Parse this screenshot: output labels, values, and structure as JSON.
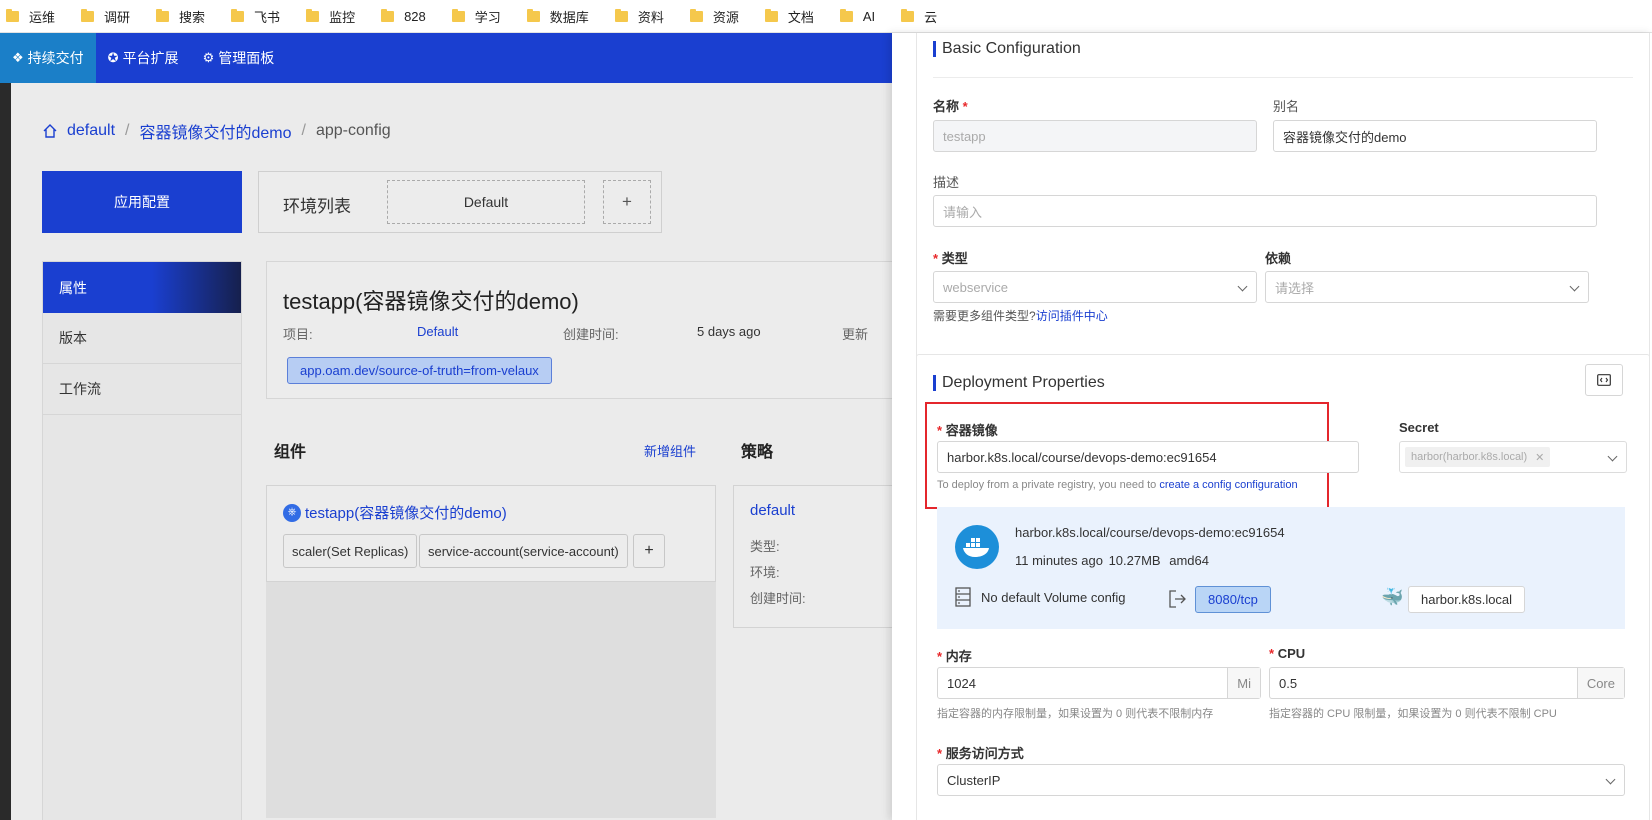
{
  "bookmarks": [
    "运维",
    "调研",
    "搜索",
    "飞书",
    "监控",
    "828",
    "学习",
    "数据库",
    "资料",
    "资源",
    "文档",
    "AI",
    "云"
  ],
  "nav": {
    "items": [
      {
        "label": "持续交付",
        "icon": "layers-icon"
      },
      {
        "label": "平台扩展",
        "icon": "plugin-icon"
      },
      {
        "label": "管理面板",
        "icon": "gear-icon"
      }
    ]
  },
  "breadcrumb": {
    "home": "default",
    "app": "容器镜像交付的demo",
    "current": "app-config"
  },
  "app_config_label": "应用配置",
  "env": {
    "label": "环境列表",
    "default": "Default",
    "add": "+"
  },
  "side_menu": [
    "属性",
    "版本",
    "工作流"
  ],
  "app_info": {
    "title": "testapp(容器镜像交付的demo)",
    "project_label": "项目:",
    "project_value": "Default",
    "created_label": "创建时间:",
    "created_value": "5 days ago",
    "updated_label": "更新",
    "tag": "app.oam.dev/source-of-truth=from-velaux"
  },
  "components": {
    "title": "组件",
    "add_label": "新增组件",
    "card": {
      "name": "testapp(容器镜像交付的demo)",
      "traits": [
        "scaler(Set Replicas)",
        "service-account(service-account)"
      ],
      "add": "+"
    }
  },
  "policies": {
    "title": "策略",
    "card": {
      "name": "default",
      "type_label": "类型:",
      "env_label": "环境:",
      "created_label": "创建时间:"
    }
  },
  "basic": {
    "title": "Basic Configuration",
    "name_label": "名称",
    "name_value": "testapp",
    "alias_label": "别名",
    "alias_value": "容器镜像交付的demo",
    "desc_label": "描述",
    "desc_placeholder": "请输入",
    "type_label": "类型",
    "type_value": "webservice",
    "depends_label": "依赖",
    "depends_placeholder": "请选择",
    "hint_prefix": "需要更多组件类型?",
    "hint_link": "访问插件中心"
  },
  "deploy": {
    "title": "Deployment Properties",
    "image_label": "容器镜像",
    "image_value": "harbor.k8s.local/course/devops-demo:ec91654",
    "image_hint_prefix": "To deploy from a private registry, you need to",
    "image_hint_link": "create a config configuration",
    "secret_label": "Secret",
    "secret_tag": "harbor(harbor.k8s.local)",
    "image_card": {
      "name": "harbor.k8s.local/course/devops-demo:ec91654",
      "age": "11 minutes ago",
      "size": "10.27MB",
      "arch": "amd64",
      "volume": "No default Volume config",
      "port": "8080/tcp",
      "registry": "harbor.k8s.local"
    },
    "memory_label": "内存",
    "memory_value": "1024",
    "memory_unit": "Mi",
    "memory_hint": "指定容器的内存限制量，如果设置为 0 则代表不限制内存",
    "cpu_label": "CPU",
    "cpu_value": "0.5",
    "cpu_unit": "Core",
    "cpu_hint": "指定容器的 CPU 限制量，如果设置为 0 则代表不限制 CPU",
    "service_label": "服务访问方式",
    "service_value": "ClusterIP"
  },
  "required_mark": "*",
  "colors": {
    "primary": "#1a3fd0",
    "active_nav": "#1b7fc8",
    "required": "#e8272a",
    "highlight_box": "#e4262c"
  }
}
